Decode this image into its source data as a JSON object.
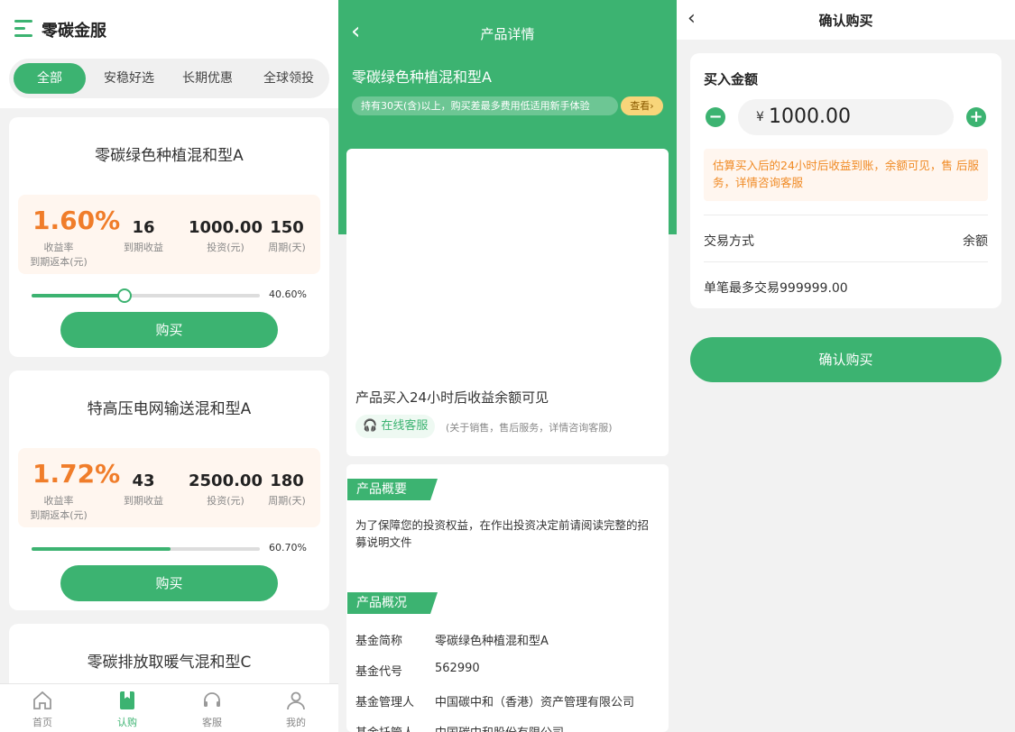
{
  "colors": {
    "primary": "#3cb371",
    "accent_orange": "#f07d2a",
    "light_orange_bg": "#fff6ef"
  },
  "list": {
    "app_title": "零碳金服",
    "tabs": [
      "全部",
      "安稳好选",
      "长期优惠",
      "全球领投"
    ],
    "active_tab": 0,
    "cards": [
      {
        "name": "零碳绿色种植混和型A",
        "rate": "1.60%",
        "rate_label": "收益率",
        "refund_label": "到期返本(元)",
        "income": "16",
        "income_label": "到期收益",
        "invest": "1000.00",
        "invest_label": "投资(元)",
        "period": "150",
        "period_label": "周期(天)",
        "progress": 0.406,
        "progress_text": "40.60%",
        "buy_label": "购买"
      },
      {
        "name": "特高压电网输送混和型A",
        "rate": "1.72%",
        "rate_label": "收益率",
        "refund_label": "到期返本(元)",
        "income": "43",
        "income_label": "到期收益",
        "invest": "2500.00",
        "invest_label": "投资(元)",
        "period": "180",
        "period_label": "周期(天)",
        "progress": 0.607,
        "progress_text": "60.70%",
        "buy_label": "购买"
      },
      {
        "name": "零碳排放取暖气混和型C"
      }
    ],
    "nav": [
      {
        "label": "首页",
        "icon": "home-icon"
      },
      {
        "label": "认购",
        "icon": "subscribe-icon"
      },
      {
        "label": "客服",
        "icon": "headset-icon"
      },
      {
        "label": "我的",
        "icon": "user-icon"
      }
    ],
    "active_nav": 1
  },
  "detail": {
    "title": "产品详情",
    "product_name": "零碳绿色种植混和型A",
    "notice": "持有30天(含)以上，购买差最多费用低适用新手体验",
    "view_label": "查看",
    "note": "产品买入24小时后收益余额可见",
    "service_label": "在线客服",
    "service_note": "(关于销售，售后服务，详情咨询客服)",
    "overview_tag": "产品概要",
    "overview_desc": "为了保障您的投资权益，在作出投资决定前请阅读完整的招募说明文件",
    "info_tag": "产品概况",
    "info_rows": [
      {
        "k": "基金简称",
        "v": "零碳绿色种植混和型A"
      },
      {
        "k": "基金代号",
        "v": "562990"
      },
      {
        "k": "基金管理人",
        "v": "中国碳中和（香港）资产管理有限公司"
      },
      {
        "k": "基金托管人",
        "v": "中国碳中和股份有限公司"
      }
    ]
  },
  "confirm": {
    "title": "确认购买",
    "amount_label": "买入金额",
    "currency": "¥",
    "amount": "1000.00",
    "tip": "估算买入后的24小时后收益到账，余额可见，售 后服务，详情咨询客服",
    "method_label": "交易方式",
    "method_value": "余额",
    "limit_text": "单笔最多交易999999.00",
    "confirm_label": "确认购买"
  }
}
